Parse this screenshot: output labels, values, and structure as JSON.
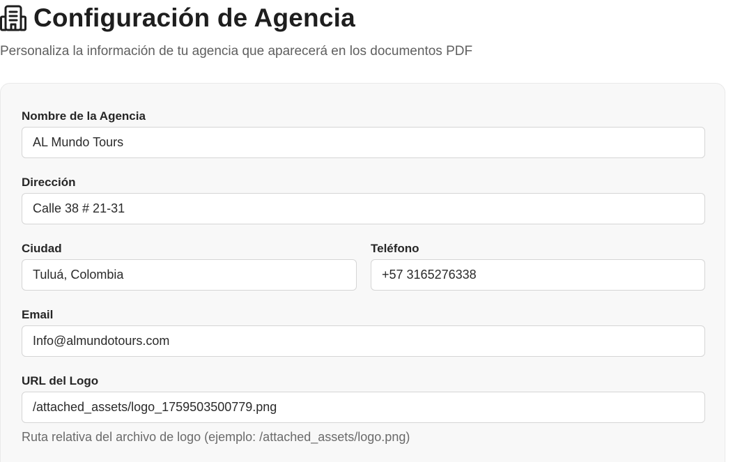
{
  "header": {
    "title": "Configuración de Agencia",
    "subtitle": "Personaliza la información de tu agencia que aparecerá en los documentos PDF",
    "icon": "building-icon"
  },
  "form": {
    "agency_name": {
      "label": "Nombre de la Agencia",
      "value": "AL Mundo Tours"
    },
    "address": {
      "label": "Dirección",
      "value": "Calle 38 # 21-31"
    },
    "city": {
      "label": "Ciudad",
      "value": "Tuluá, Colombia"
    },
    "phone": {
      "label": "Teléfono",
      "value": "+57 3165276338"
    },
    "email": {
      "label": "Email",
      "value": "Info@almundotours.com"
    },
    "logo_url": {
      "label": "URL del Logo",
      "value": "/attached_assets/logo_1759503500779.png",
      "hint": "Ruta relativa del archivo de logo (ejemplo: /attached_assets/logo.png)"
    }
  },
  "colors": {
    "card_background": "#f8f8f8",
    "input_border": "#d5d5d5",
    "title_text": "#1e1e1e",
    "muted_text": "#5f5f5f"
  }
}
